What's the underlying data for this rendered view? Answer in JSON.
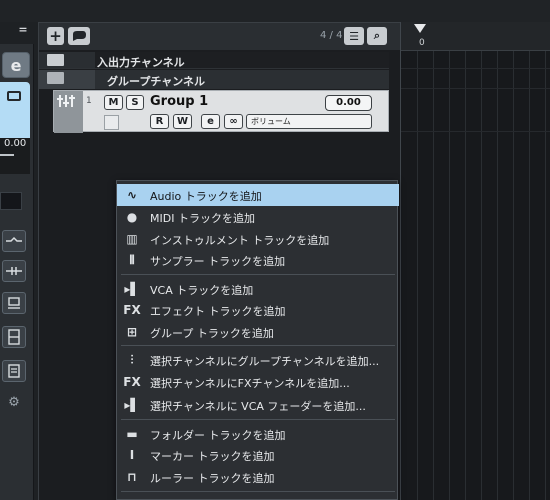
{
  "left_strip": {
    "eq_icon": "=",
    "edit_button": "e",
    "value_readout": "0.00"
  },
  "toolbar": {
    "add_label": "+",
    "chat_label": "●",
    "track_count": "4 / 4",
    "list_icon": "☰",
    "search_icon": "⌕"
  },
  "ruler": {
    "position_label": "0"
  },
  "tracks": [
    {
      "label": "入出力チャンネル",
      "kind": "folder"
    },
    {
      "label": "グループチャンネル",
      "kind": "folder"
    }
  ],
  "group_track": {
    "number": "1",
    "mute": "M",
    "solo": "S",
    "name": "Group 1",
    "volume": "0.00",
    "read": "R",
    "write": "W",
    "edit": "e",
    "link": "∞",
    "automation_param": "ボリューム"
  },
  "context_menu": {
    "items": [
      {
        "label": "Audio トラックを追加",
        "icon": "waveform-icon",
        "glyph": "∿",
        "highlighted": true
      },
      {
        "label": "MIDI トラックを追加",
        "icon": "midi-icon",
        "glyph": "●"
      },
      {
        "label": "インストゥルメント トラックを追加",
        "icon": "keyboard-icon",
        "glyph": "▥"
      },
      {
        "label": "サンプラー トラックを追加",
        "icon": "sampler-icon",
        "glyph": "⫴"
      },
      {
        "label": "VCA トラックを追加",
        "icon": "vca-icon",
        "glyph": "▸▌"
      },
      {
        "label": "エフェクト トラックを追加",
        "icon": "fx-icon",
        "glyph": "FX"
      },
      {
        "label": "グループ トラックを追加",
        "icon": "group-icon",
        "glyph": "⊞"
      },
      {
        "label": "選択チャンネルにグループチャンネルを追加...",
        "icon": "group-channel-icon",
        "glyph": "⫶"
      },
      {
        "label": "選択チャンネルにFXチャンネルを追加...",
        "icon": "fx-icon",
        "glyph": "FX"
      },
      {
        "label": "選択チャンネルに VCA フェーダーを追加...",
        "icon": "vca-icon",
        "glyph": "▸▌"
      },
      {
        "label": "フォルダー トラックを追加",
        "icon": "folder-icon",
        "glyph": "▬"
      },
      {
        "label": "マーカー トラックを追加",
        "icon": "marker-icon",
        "glyph": "I"
      },
      {
        "label": "ルーラー トラックを追加",
        "icon": "ruler-icon",
        "glyph": "⊓"
      }
    ]
  },
  "colors": {
    "highlight": "#a9d2f0",
    "lock_active": "#b4dcf5",
    "track_bg": "#dfe1e3"
  }
}
